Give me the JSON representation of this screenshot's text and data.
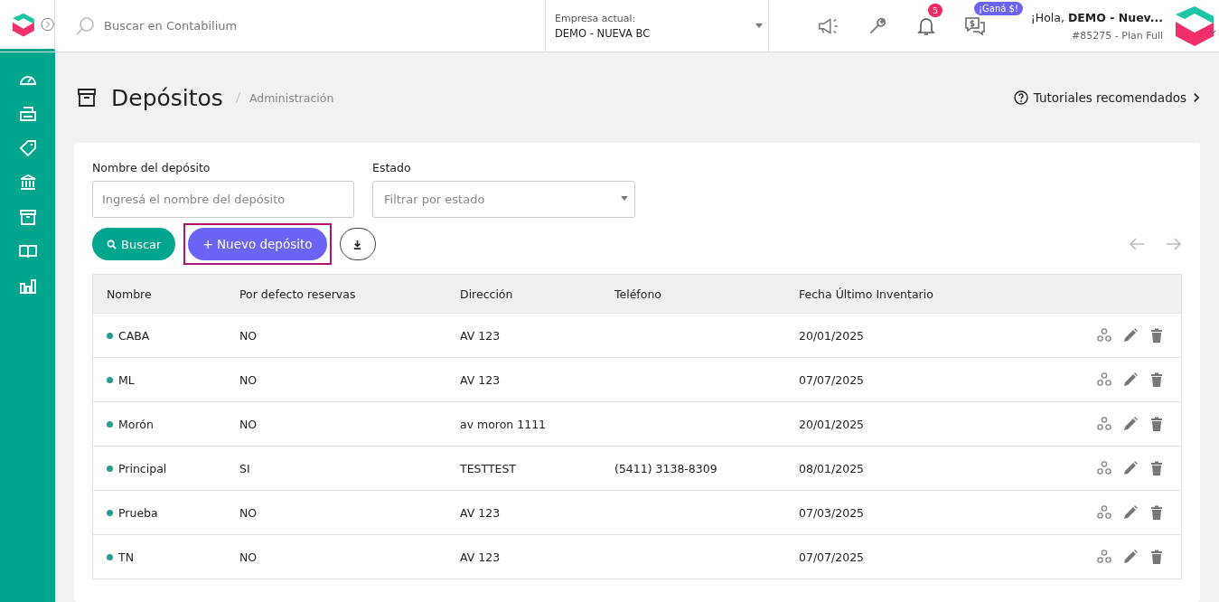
{
  "topbar": {
    "search": {
      "placeholder": "Buscar en Contabilium"
    },
    "company": {
      "label": "Empresa actual:",
      "value": "DEMO - NUEVA BC"
    },
    "notifications": {
      "count": "5"
    },
    "promo": "¡Ganá $!",
    "greeting": "¡Hola, **DEMO - Nuev...**",
    "account": "#85275 - Plan Full"
  },
  "page": {
    "title": "Depósitos",
    "breadcrumb": "Administración",
    "tutorials": "Tutoriales recomendados"
  },
  "filters": [
    {
      "kind": "text",
      "label": "Nombre del depósito",
      "placeholder": "Ingresá el nombre del depósito"
    },
    {
      "kind": "select",
      "label": "Estado",
      "placeholder": "Filtrar por estado"
    }
  ],
  "actions": {
    "search": "Buscar",
    "new": {
      "label": "+ Nuevo depósito",
      "highlighted": true
    }
  },
  "table": {
    "columns": [
      "Nombre",
      "Por defecto reservas",
      "Dirección",
      "Teléfono",
      "Fecha Último Inventario"
    ],
    "rows": [
      {
        "name": "CABA",
        "color": "#2a9d8f",
        "default": "NO",
        "address": "AV 123",
        "date": "20/01/2025"
      },
      {
        "name": "ML",
        "color": "#2a9d8f",
        "default": "NO",
        "address": "AV 123",
        "date": "07/07/2025"
      },
      {
        "name": "Morón",
        "color": "#2a9d8f",
        "default": "NO",
        "address": "av moron 1111",
        "date": "20/01/2025"
      },
      {
        "name": "Principal",
        "color": "#2a9d8f",
        "default": "SI",
        "address": "TESTTEST",
        "phone": "(5411) 3138-8309",
        "date": "08/01/2025"
      },
      {
        "name": "Prueba",
        "color": "#2a9d8f",
        "default": "NO",
        "address": "AV 123",
        "date": "07/03/2025"
      },
      {
        "name": "TN",
        "color": "#2a9d8f",
        "default": "NO",
        "address": "AV 123",
        "date": "07/07/2025"
      }
    ]
  }
}
